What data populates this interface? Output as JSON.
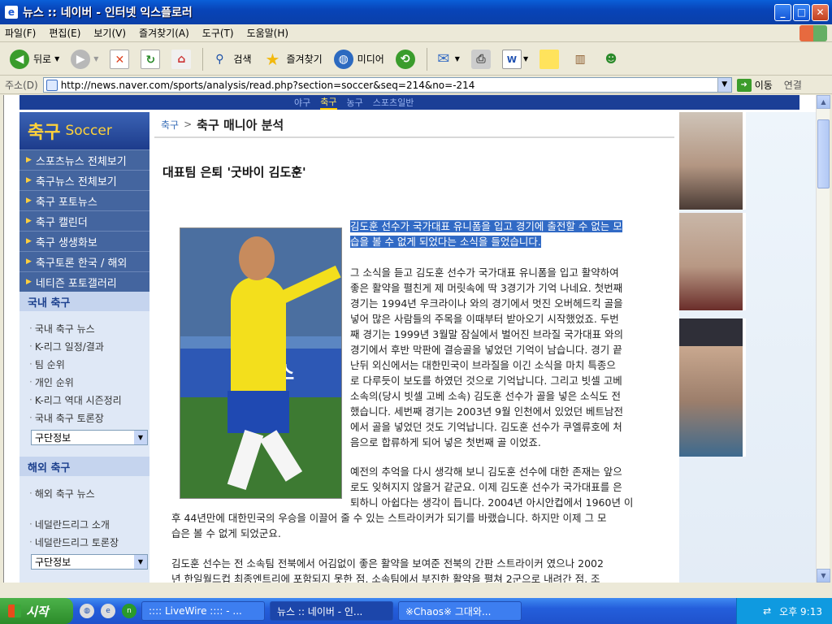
{
  "window": {
    "title": "뉴스 :: 네이버 - 인터넷 익스플로러"
  },
  "menu": [
    "파일(F)",
    "편집(E)",
    "보기(V)",
    "즐겨찾기(A)",
    "도구(T)",
    "도움말(H)"
  ],
  "toolbar": {
    "back": "뒤로",
    "search": "검색",
    "favorites": "즐겨찾기",
    "media": "미디어"
  },
  "address": {
    "label": "주소(D)",
    "url": "http://news.naver.com/sports/analysis/read.php?section=soccer&seq=214&no=-214",
    "go": "이동",
    "links": "연결"
  },
  "topnav": [
    "야구",
    "축구",
    "농구",
    "스포츠일반"
  ],
  "sidebar": {
    "title_kr": "축구",
    "title_en": "Soccer",
    "items": [
      "스포츠뉴스 전체보기",
      "축구뉴스 전체보기",
      "축구 포토뉴스",
      "축구 캘린더",
      "축구 생생화보",
      "축구토론 한국 / 해외",
      "네티즌 포토갤러리"
    ],
    "domestic": {
      "title": "국내 축구",
      "links": [
        "국내 축구 뉴스",
        "K-리그 일정/결과",
        "팀 순위",
        "개인 순위",
        "K-리그 역대 시즌정리",
        "국내 축구 토론장"
      ],
      "select": "구단정보"
    },
    "foreign": {
      "title": "해외 축구",
      "links": [
        "해외 축구 뉴스",
        "네덜란드리그 소개",
        "네덜란드리그 토론장"
      ],
      "select": "구단정보"
    }
  },
  "breadcrumb": {
    "section": "축구",
    "page": "축구 매니아 분석"
  },
  "article": {
    "headline": "대표팀 은퇴 '굿바이 김도훈'",
    "photo_text": "뉴스",
    "p1a": "김도훈 선수가 국가대표 유니폼을 입고 경기에 출전할 수 없는 모",
    "p1b": "습을 볼 수 없게 되었다는 소식을 들었습니다.",
    "p2": [
      "그 소식을 듣고 김도훈 선수가 국가대표 유니폼을 입고 활약하여",
      "좋은 활약을 펼친게 제 머릿속에 딱 3경기가 기억 나네요. 첫번째",
      "경기는 1994년 우크라이나 와의 경기에서 멋진 오버헤드킥 골을",
      "넣어 많은 사람들의 주목을 이때부터 받아오기 시작했었죠. 두번",
      "째 경기는 1999년 3월말 잠실에서 벌어진 브라질 국가대표 와의",
      "경기에서 후반 막판에 결승골을 넣었던 기억이 남습니다. 경기 끝",
      "난뒤 외신에서는 대한민국이 브라질을 이긴 소식을 마치 특종으",
      "로 다루듯이 보도를 하였던 것으로 기억납니다. 그리고 빗셀 고베",
      "소속의(당시 빗셀 고베 소속) 김도훈 선수가 골을 넣은 소식도 전",
      "했습니다. 세번째 경기는 2003년 9월 인천에서 있었던 베트남전",
      "에서 골을 넣었던 것도 기억납니다. 김도훈 선수가 쿠엘류호에 처",
      "음으로 합류하게 되어 넣은 첫번째 골 이었죠."
    ],
    "p3": [
      "예전의 추억을 다시 생각해 보니 김도훈 선수에 대한 존재는 앞으",
      "로도 잊혀지지 않을거 같군요. 이제 김도훈 선수가 국가대표를 은",
      "퇴하니 아쉽다는 생각이 듭니다. 2004년 아시안컵에서 1960년 이"
    ],
    "p3wide": [
      "후 44년만에 대한민국의 우승을 이끌어 줄 수 있는 스트라이커가 되기를 바랬습니다. 하지만 이제 그 모",
      "습은 볼 수 없게 되었군요."
    ],
    "p4": [
      "김도훈 선수는 전 소속팀 전북에서 어김없이 좋은 활약을 보여준 전북의 간판 스트라이커 였으나 2002",
      "년 한일월드컵 최종엔트리에 포함되지 못한 점, 소속팀에서 부진한 활약을 펼쳐 2군으로 내려간 점, 조"
    ]
  },
  "taskbar": {
    "start": "시작",
    "tasks": [
      ":::: LiveWire :::: - ...",
      "뉴스 :: 네이버 - 인...",
      "※Chaos※ 그대와..."
    ],
    "clock": "오후 9:13"
  }
}
